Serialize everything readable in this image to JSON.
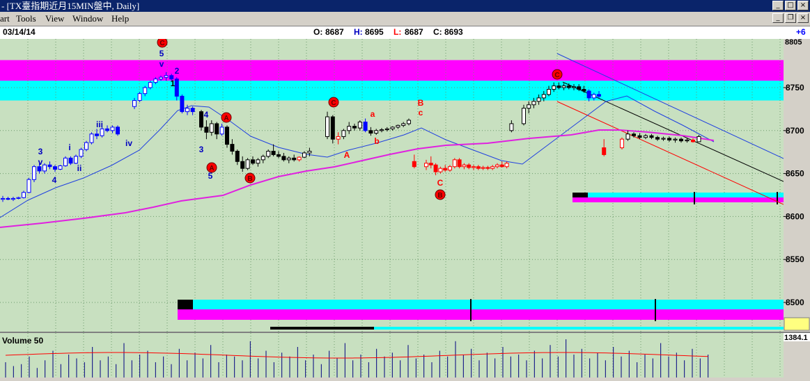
{
  "window": {
    "title": "- [TX臺指期近月15MIN盤中, Daily]",
    "min_glyph": "_",
    "max_glyph": "□",
    "close_glyph": "×",
    "restore_glyph": "❐"
  },
  "menu": {
    "items": [
      "art",
      "Tools",
      "View",
      "Window",
      "Help"
    ]
  },
  "info": {
    "date": "03/14/14",
    "open_label": "O:",
    "open": "8687",
    "high_label": "H:",
    "high": "8695",
    "low_label": "L:",
    "low": "8687",
    "close_label": "C:",
    "close": "8693",
    "change": "+6"
  },
  "colors": {
    "background": "#c8e0c0",
    "magenta_band": "#ff00ff",
    "cyan_band": "#00ffff",
    "up_candle": "#ffffff",
    "down_candle": "#000000",
    "blue_candle": "#0000ff",
    "red_candle": "#ff0000",
    "ma_short": "#2040e0",
    "ma_long": "#e020e0",
    "wave_label_blue": "#0000c0",
    "wave_label_red": "#ff0000"
  },
  "chart_data": [
    {
      "type": "candlestick",
      "ylim": [
        8580,
        8765
      ],
      "y_ticks": [
        8500,
        8550,
        8600,
        8650,
        8700,
        8750
      ],
      "y_tick_labels": [
        "8500",
        "8550",
        "8600",
        "8650",
        "8700",
        "8750"
      ],
      "top_tick_label": "8805",
      "grid": true,
      "bands": [
        {
          "name": "resistance-magenta",
          "y_top": 8782,
          "y_bottom": 8758,
          "color": "#ff00ff"
        },
        {
          "name": "resistance-cyan",
          "y_top": 8758,
          "y_bottom": 8735,
          "color": "#00ffff"
        }
      ],
      "candles": [
        {
          "o": 8620,
          "h": 8624,
          "l": 8617,
          "c": 8621,
          "col": "b"
        },
        {
          "o": 8621,
          "h": 8623,
          "l": 8619,
          "c": 8620,
          "col": "b"
        },
        {
          "o": 8620,
          "h": 8623,
          "l": 8618,
          "c": 8621,
          "col": "b"
        },
        {
          "o": 8621,
          "h": 8623,
          "l": 8620,
          "c": 8622,
          "col": "b"
        },
        {
          "o": 8622,
          "h": 8630,
          "l": 8621,
          "c": 8628,
          "col": "b"
        },
        {
          "o": 8628,
          "h": 8645,
          "l": 8627,
          "c": 8643,
          "col": "b"
        },
        {
          "o": 8643,
          "h": 8660,
          "l": 8640,
          "c": 8658,
          "col": "b"
        },
        {
          "o": 8658,
          "h": 8662,
          "l": 8650,
          "c": 8653,
          "col": "b"
        },
        {
          "o": 8653,
          "h": 8662,
          "l": 8650,
          "c": 8660,
          "col": "b"
        },
        {
          "o": 8660,
          "h": 8664,
          "l": 8655,
          "c": 8658,
          "col": "b"
        },
        {
          "o": 8658,
          "h": 8660,
          "l": 8652,
          "c": 8655,
          "col": "b"
        },
        {
          "o": 8655,
          "h": 8660,
          "l": 8654,
          "c": 8659,
          "col": "b"
        },
        {
          "o": 8659,
          "h": 8670,
          "l": 8658,
          "c": 8668,
          "col": "b"
        },
        {
          "o": 8668,
          "h": 8670,
          "l": 8660,
          "c": 8662,
          "col": "b"
        },
        {
          "o": 8662,
          "h": 8672,
          "l": 8661,
          "c": 8670,
          "col": "b"
        },
        {
          "o": 8670,
          "h": 8680,
          "l": 8668,
          "c": 8678,
          "col": "b"
        },
        {
          "o": 8678,
          "h": 8688,
          "l": 8676,
          "c": 8686,
          "col": "b"
        },
        {
          "o": 8686,
          "h": 8698,
          "l": 8684,
          "c": 8696,
          "col": "b"
        },
        {
          "o": 8696,
          "h": 8702,
          "l": 8690,
          "c": 8694,
          "col": "b"
        },
        {
          "o": 8694,
          "h": 8705,
          "l": 8692,
          "c": 8702,
          "col": "b"
        },
        {
          "o": 8702,
          "h": 8706,
          "l": 8698,
          "c": 8700,
          "col": "b"
        },
        {
          "o": 8700,
          "h": 8706,
          "l": 8697,
          "c": 8704,
          "col": "b"
        },
        {
          "o": 8704,
          "h": 8706,
          "l": 8694,
          "c": 8696,
          "col": "b"
        },
        {
          "o": 8728,
          "h": 8738,
          "l": 8725,
          "c": 8735,
          "col": "b"
        },
        {
          "o": 8735,
          "h": 8745,
          "l": 8733,
          "c": 8743,
          "col": "b"
        },
        {
          "o": 8743,
          "h": 8752,
          "l": 8740,
          "c": 8750,
          "col": "b"
        },
        {
          "o": 8750,
          "h": 8758,
          "l": 8748,
          "c": 8756,
          "col": "b"
        },
        {
          "o": 8756,
          "h": 8762,
          "l": 8754,
          "c": 8760,
          "col": "b"
        },
        {
          "o": 8760,
          "h": 8764,
          "l": 8758,
          "c": 8762,
          "col": "b"
        },
        {
          "o": 8762,
          "h": 8768,
          "l": 8758,
          "c": 8764,
          "col": "b"
        },
        {
          "o": 8764,
          "h": 8766,
          "l": 8758,
          "c": 8760,
          "col": "b"
        },
        {
          "o": 8760,
          "h": 8762,
          "l": 8735,
          "c": 8740,
          "col": "b"
        },
        {
          "o": 8740,
          "h": 8742,
          "l": 8720,
          "c": 8722,
          "col": "b"
        },
        {
          "o": 8722,
          "h": 8730,
          "l": 8718,
          "c": 8726,
          "col": "b"
        },
        {
          "o": 8726,
          "h": 8728,
          "l": 8718,
          "c": 8722,
          "col": "b"
        },
        {
          "o": 8722,
          "h": 8724,
          "l": 8700,
          "c": 8704,
          "col": "k"
        },
        {
          "o": 8704,
          "h": 8712,
          "l": 8690,
          "c": 8698,
          "col": "k"
        },
        {
          "o": 8698,
          "h": 8712,
          "l": 8694,
          "c": 8708,
          "col": "k"
        },
        {
          "o": 8708,
          "h": 8710,
          "l": 8690,
          "c": 8696,
          "col": "k"
        },
        {
          "o": 8696,
          "h": 8708,
          "l": 8694,
          "c": 8704,
          "col": "b"
        },
        {
          "o": 8704,
          "h": 8706,
          "l": 8680,
          "c": 8684,
          "col": "k"
        },
        {
          "o": 8684,
          "h": 8690,
          "l": 8672,
          "c": 8676,
          "col": "k"
        },
        {
          "o": 8676,
          "h": 8678,
          "l": 8660,
          "c": 8664,
          "col": "k"
        },
        {
          "o": 8664,
          "h": 8670,
          "l": 8652,
          "c": 8656,
          "col": "k"
        },
        {
          "o": 8656,
          "h": 8668,
          "l": 8654,
          "c": 8666,
          "col": "k"
        },
        {
          "o": 8666,
          "h": 8670,
          "l": 8660,
          "c": 8662,
          "col": "k"
        },
        {
          "o": 8662,
          "h": 8668,
          "l": 8658,
          "c": 8666,
          "col": "k"
        },
        {
          "o": 8666,
          "h": 8672,
          "l": 8662,
          "c": 8670,
          "col": "k"
        },
        {
          "o": 8670,
          "h": 8678,
          "l": 8668,
          "c": 8676,
          "col": "k"
        },
        {
          "o": 8676,
          "h": 8684,
          "l": 8670,
          "c": 8672,
          "col": "k"
        },
        {
          "o": 8672,
          "h": 8676,
          "l": 8668,
          "c": 8670,
          "col": "k"
        },
        {
          "o": 8670,
          "h": 8674,
          "l": 8664,
          "c": 8666,
          "col": "k"
        },
        {
          "o": 8666,
          "h": 8670,
          "l": 8662,
          "c": 8668,
          "col": "k"
        },
        {
          "o": 8668,
          "h": 8672,
          "l": 8664,
          "c": 8666,
          "col": "k"
        },
        {
          "o": 8666,
          "h": 8670,
          "l": 8664,
          "c": 8669,
          "col": "r"
        },
        {
          "o": 8669,
          "h": 8676,
          "l": 8668,
          "c": 8674,
          "col": "k"
        },
        {
          "o": 8674,
          "h": 8680,
          "l": 8670,
          "c": 8676,
          "col": "k"
        },
        {
          "o": 8693,
          "h": 8722,
          "l": 8690,
          "c": 8716,
          "col": "k"
        },
        {
          "o": 8716,
          "h": 8718,
          "l": 8685,
          "c": 8690,
          "col": "k"
        },
        {
          "o": 8690,
          "h": 8698,
          "l": 8684,
          "c": 8693,
          "col": "r"
        },
        {
          "o": 8693,
          "h": 8702,
          "l": 8690,
          "c": 8700,
          "col": "k"
        },
        {
          "o": 8700,
          "h": 8710,
          "l": 8696,
          "c": 8705,
          "col": "k"
        },
        {
          "o": 8705,
          "h": 8708,
          "l": 8700,
          "c": 8703,
          "col": "k"
        },
        {
          "o": 8703,
          "h": 8712,
          "l": 8700,
          "c": 8710,
          "col": "k"
        },
        {
          "o": 8710,
          "h": 8714,
          "l": 8698,
          "c": 8700,
          "col": "b"
        },
        {
          "o": 8700,
          "h": 8704,
          "l": 8694,
          "c": 8697,
          "col": "k"
        },
        {
          "o": 8697,
          "h": 8702,
          "l": 8695,
          "c": 8700,
          "col": "k"
        },
        {
          "o": 8700,
          "h": 8703,
          "l": 8698,
          "c": 8701,
          "col": "k"
        },
        {
          "o": 8701,
          "h": 8704,
          "l": 8699,
          "c": 8702,
          "col": "k"
        },
        {
          "o": 8702,
          "h": 8705,
          "l": 8700,
          "c": 8704,
          "col": "k"
        },
        {
          "o": 8704,
          "h": 8707,
          "l": 8702,
          "c": 8706,
          "col": "k"
        },
        {
          "o": 8706,
          "h": 8710,
          "l": 8704,
          "c": 8708,
          "col": "k"
        },
        {
          "o": 8708,
          "h": 8714,
          "l": 8706,
          "c": 8712,
          "col": "k"
        },
        {
          "o": 8664,
          "h": 8672,
          "l": 8656,
          "c": 8658,
          "col": "r"
        },
        {
          "o": 8658,
          "h": 8666,
          "l": 8654,
          "c": 8662,
          "col": "r"
        },
        {
          "o": 8662,
          "h": 8670,
          "l": 8656,
          "c": 8660,
          "col": "r"
        },
        {
          "o": 8660,
          "h": 8662,
          "l": 8648,
          "c": 8652,
          "col": "r"
        },
        {
          "o": 8652,
          "h": 8658,
          "l": 8650,
          "c": 8656,
          "col": "r"
        },
        {
          "o": 8656,
          "h": 8660,
          "l": 8652,
          "c": 8654,
          "col": "r"
        },
        {
          "o": 8654,
          "h": 8660,
          "l": 8652,
          "c": 8658,
          "col": "r"
        },
        {
          "o": 8658,
          "h": 8668,
          "l": 8656,
          "c": 8666,
          "col": "r"
        },
        {
          "o": 8666,
          "h": 8668,
          "l": 8656,
          "c": 8658,
          "col": "r"
        },
        {
          "o": 8658,
          "h": 8662,
          "l": 8655,
          "c": 8660,
          "col": "r"
        },
        {
          "o": 8660,
          "h": 8662,
          "l": 8655,
          "c": 8657,
          "col": "r"
        },
        {
          "o": 8657,
          "h": 8660,
          "l": 8654,
          "c": 8658,
          "col": "r"
        },
        {
          "o": 8658,
          "h": 8660,
          "l": 8654,
          "c": 8656,
          "col": "r"
        },
        {
          "o": 8656,
          "h": 8659,
          "l": 8654,
          "c": 8657,
          "col": "r"
        },
        {
          "o": 8657,
          "h": 8659,
          "l": 8654,
          "c": 8656,
          "col": "r"
        },
        {
          "o": 8656,
          "h": 8660,
          "l": 8654,
          "c": 8658,
          "col": "r"
        },
        {
          "o": 8658,
          "h": 8662,
          "l": 8656,
          "c": 8660,
          "col": "r"
        },
        {
          "o": 8660,
          "h": 8664,
          "l": 8657,
          "c": 8658,
          "col": "r"
        },
        {
          "o": 8658,
          "h": 8664,
          "l": 8656,
          "c": 8662,
          "col": "r"
        },
        {
          "o": 8700,
          "h": 8712,
          "l": 8698,
          "c": 8708,
          "col": "k"
        },
        {
          "o": 8708,
          "h": 8730,
          "l": 8706,
          "c": 8726,
          "col": "k"
        },
        {
          "o": 8726,
          "h": 8734,
          "l": 8720,
          "c": 8730,
          "col": "k"
        },
        {
          "o": 8730,
          "h": 8738,
          "l": 8726,
          "c": 8734,
          "col": "k"
        },
        {
          "o": 8734,
          "h": 8742,
          "l": 8730,
          "c": 8738,
          "col": "k"
        },
        {
          "o": 8738,
          "h": 8746,
          "l": 8734,
          "c": 8742,
          "col": "k"
        },
        {
          "o": 8742,
          "h": 8752,
          "l": 8740,
          "c": 8748,
          "col": "k"
        },
        {
          "o": 8748,
          "h": 8756,
          "l": 8745,
          "c": 8752,
          "col": "k"
        },
        {
          "o": 8752,
          "h": 8756,
          "l": 8748,
          "c": 8750,
          "col": "k"
        },
        {
          "o": 8750,
          "h": 8755,
          "l": 8747,
          "c": 8752,
          "col": "k"
        },
        {
          "o": 8752,
          "h": 8755,
          "l": 8748,
          "c": 8750,
          "col": "k"
        },
        {
          "o": 8750,
          "h": 8754,
          "l": 8747,
          "c": 8751,
          "col": "k"
        },
        {
          "o": 8751,
          "h": 8754,
          "l": 8746,
          "c": 8748,
          "col": "k"
        },
        {
          "o": 8748,
          "h": 8752,
          "l": 8744,
          "c": 8746,
          "col": "k"
        },
        {
          "o": 8746,
          "h": 8748,
          "l": 8734,
          "c": 8738,
          "col": "b"
        },
        {
          "o": 8738,
          "h": 8744,
          "l": 8735,
          "c": 8742,
          "col": "b"
        },
        {
          "o": 8742,
          "h": 8746,
          "l": 8738,
          "c": 8740,
          "col": "b"
        },
        {
          "o": 8680,
          "h": 8690,
          "l": 8670,
          "c": 8672,
          "col": "r"
        },
        {
          "o": 8680,
          "h": 8692,
          "l": 8678,
          "c": 8690,
          "col": "r"
        },
        {
          "o": 8690,
          "h": 8700,
          "l": 8688,
          "c": 8696,
          "col": "k"
        },
        {
          "o": 8696,
          "h": 8698,
          "l": 8692,
          "c": 8694,
          "col": "k"
        },
        {
          "o": 8694,
          "h": 8697,
          "l": 8690,
          "c": 8692,
          "col": "k"
        },
        {
          "o": 8692,
          "h": 8696,
          "l": 8690,
          "c": 8694,
          "col": "k"
        },
        {
          "o": 8694,
          "h": 8696,
          "l": 8690,
          "c": 8692,
          "col": "k"
        },
        {
          "o": 8692,
          "h": 8694,
          "l": 8688,
          "c": 8690,
          "col": "k"
        },
        {
          "o": 8690,
          "h": 8693,
          "l": 8688,
          "c": 8691,
          "col": "k"
        },
        {
          "o": 8691,
          "h": 8693,
          "l": 8687,
          "c": 8689,
          "col": "k"
        },
        {
          "o": 8689,
          "h": 8692,
          "l": 8686,
          "c": 8690,
          "col": "k"
        },
        {
          "o": 8690,
          "h": 8692,
          "l": 8686,
          "c": 8688,
          "col": "k"
        },
        {
          "o": 8688,
          "h": 8691,
          "l": 8686,
          "c": 8689,
          "col": "k"
        },
        {
          "o": 8689,
          "h": 8691,
          "l": 8686,
          "c": 8687,
          "col": "r"
        },
        {
          "o": 8687,
          "h": 8695,
          "l": 8687,
          "c": 8693,
          "col": "k"
        }
      ],
      "wave_labels": [
        {
          "text": "3",
          "color": "blue"
        },
        {
          "text": "v",
          "color": "blue"
        },
        {
          "text": "4",
          "color": "blue"
        },
        {
          "text": "i",
          "color": "blue"
        },
        {
          "text": "ii",
          "color": "blue"
        },
        {
          "text": "iii",
          "color": "blue"
        },
        {
          "text": "iv",
          "color": "blue"
        },
        {
          "text": "5",
          "color": "blue"
        },
        {
          "text": "v",
          "color": "blue"
        },
        {
          "text": "1",
          "color": "black"
        },
        {
          "text": "2",
          "color": "blue"
        },
        {
          "text": "3",
          "color": "blue"
        },
        {
          "text": "4",
          "color": "blue"
        },
        {
          "text": "5",
          "color": "blue"
        },
        {
          "text": "a",
          "color": "red"
        },
        {
          "text": "b",
          "color": "red"
        },
        {
          "text": "c",
          "color": "red"
        },
        {
          "text": "B",
          "color": "red"
        },
        {
          "text": "A",
          "color": "red"
        },
        {
          "text": "C",
          "color": "red"
        }
      ],
      "circled_labels": [
        "C",
        "A",
        "B",
        "C",
        "A",
        "B",
        "C"
      ]
    },
    {
      "type": "bar",
      "title": "Volume 50",
      "axis_label": "1384.1",
      "values": [
        40,
        30,
        35,
        55,
        25,
        45,
        70,
        35,
        60,
        50,
        40,
        80,
        45,
        55,
        35,
        90,
        45,
        60,
        70,
        40,
        55,
        35,
        75,
        45,
        65,
        50,
        85,
        40,
        60,
        55,
        45,
        95,
        50,
        70,
        40,
        65,
        55,
        80,
        45,
        60,
        35,
        70,
        50,
        90,
        45,
        60,
        40,
        75,
        55,
        65,
        45,
        85,
        50,
        60,
        40,
        70,
        55,
        95,
        60,
        75,
        45,
        65,
        50,
        80,
        55,
        60,
        45,
        70,
        50,
        85,
        55,
        100,
        60,
        75,
        50,
        65,
        45,
        80,
        55,
        70,
        40,
        60,
        50,
        90,
        55,
        65,
        45,
        75,
        50,
        60
      ]
    }
  ]
}
